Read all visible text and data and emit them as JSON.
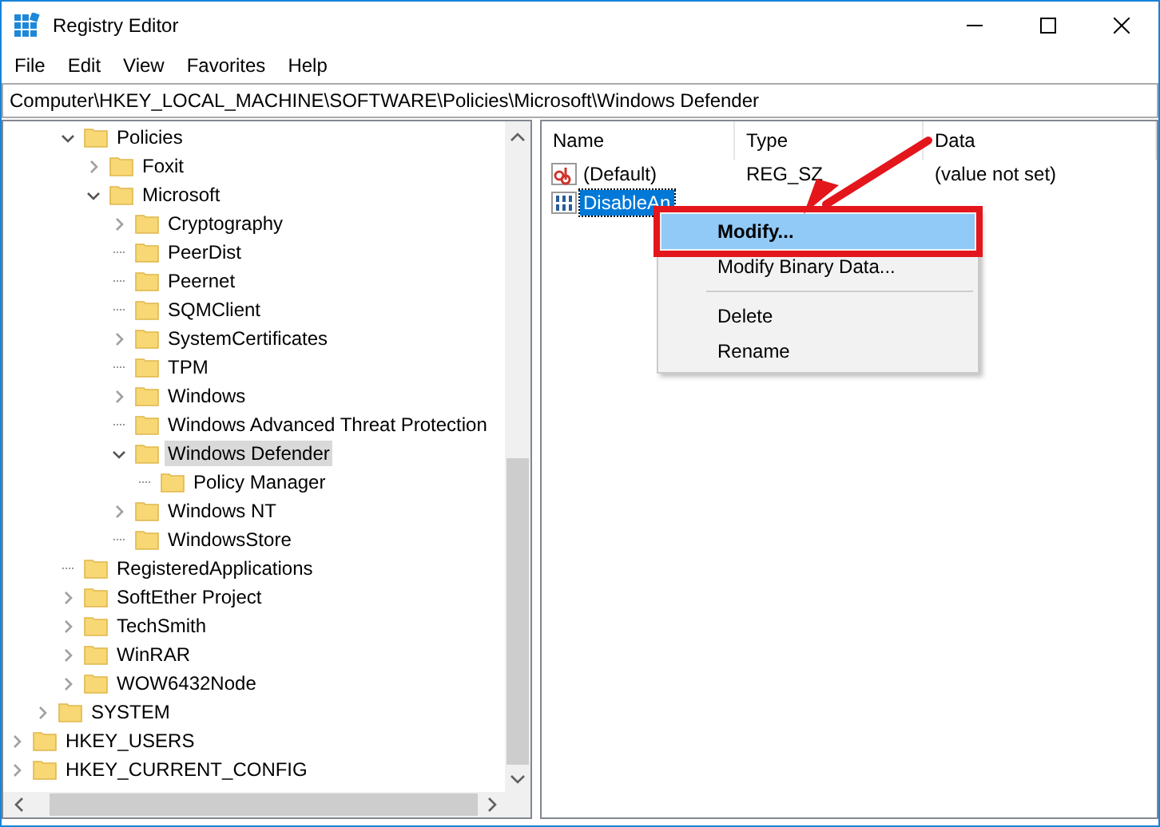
{
  "window": {
    "title": "Registry Editor"
  },
  "menu_bar": [
    "File",
    "Edit",
    "View",
    "Favorites",
    "Help"
  ],
  "address_bar": {
    "value": "Computer\\HKEY_LOCAL_MACHINE\\SOFTWARE\\Policies\\Microsoft\\Windows Defender"
  },
  "tree": [
    {
      "children": [
        {
          "children": [
            {
              "children": [
                {
                  "label": "Policies",
                  "expandable": true,
                  "expanded": true,
                  "selected": false,
                  "children": [
                    {
                      "label": "Foxit",
                      "expandable": true,
                      "expanded": false,
                      "selected": false
                    },
                    {
                      "label": "Microsoft",
                      "expandable": true,
                      "expanded": true,
                      "selected": false,
                      "children": [
                        {
                          "label": "Cryptography",
                          "expandable": true,
                          "expanded": false,
                          "selected": false
                        },
                        {
                          "label": "PeerDist",
                          "expandable": false,
                          "selected": false
                        },
                        {
                          "label": "Peernet",
                          "expandable": false,
                          "selected": false
                        },
                        {
                          "label": "SQMClient",
                          "expandable": false,
                          "selected": false
                        },
                        {
                          "label": "SystemCertificates",
                          "expandable": true,
                          "expanded": false,
                          "selected": false
                        },
                        {
                          "label": "TPM",
                          "expandable": false,
                          "selected": false
                        },
                        {
                          "label": "Windows",
                          "expandable": true,
                          "expanded": false,
                          "selected": false
                        },
                        {
                          "label": "Windows Advanced Threat Protection",
                          "expandable": false,
                          "selected": false
                        },
                        {
                          "label": "Windows Defender",
                          "expandable": true,
                          "expanded": true,
                          "selected": true,
                          "children": [
                            {
                              "label": "Policy Manager",
                              "expandable": false,
                              "selected": false
                            }
                          ]
                        },
                        {
                          "label": "Windows NT",
                          "expandable": true,
                          "expanded": false,
                          "selected": false
                        },
                        {
                          "label": "WindowsStore",
                          "expandable": false,
                          "selected": false
                        }
                      ]
                    }
                  ]
                },
                {
                  "label": "RegisteredApplications",
                  "expandable": false,
                  "selected": false
                },
                {
                  "label": "SoftEther Project",
                  "expandable": true,
                  "expanded": false,
                  "selected": false
                },
                {
                  "label": "TechSmith",
                  "expandable": true,
                  "expanded": false,
                  "selected": false
                },
                {
                  "label": "WinRAR",
                  "expandable": true,
                  "expanded": false,
                  "selected": false
                },
                {
                  "label": "WOW6432Node",
                  "expandable": true,
                  "expanded": false,
                  "selected": false
                }
              ]
            },
            {
              "label": "SYSTEM",
              "expandable": true,
              "expanded": false,
              "selected": false
            }
          ]
        },
        {
          "label": "HKEY_USERS",
          "expandable": true,
          "expanded": false,
          "selected": false
        },
        {
          "label": "HKEY_CURRENT_CONFIG",
          "expandable": true,
          "expanded": false,
          "selected": false
        }
      ]
    }
  ],
  "values": {
    "columns": [
      "Name",
      "Type",
      "Data"
    ],
    "rows": [
      {
        "name": "(Default)",
        "type": "REG_SZ",
        "data": "(value not set)",
        "kind": "string",
        "selected": false
      },
      {
        "name": "DisableAn",
        "kind": "binary",
        "selected": true
      }
    ]
  },
  "context_menu": [
    {
      "kind": "item",
      "label": "Modify...",
      "selected": true,
      "highlighted": true
    },
    {
      "kind": "item",
      "label": "Modify Binary Data...",
      "selected": false,
      "highlighted": false
    },
    {
      "kind": "separator"
    },
    {
      "kind": "item",
      "label": "Delete",
      "selected": false,
      "highlighted": false
    },
    {
      "kind": "item",
      "label": "Rename",
      "selected": false,
      "highlighted": false
    }
  ]
}
